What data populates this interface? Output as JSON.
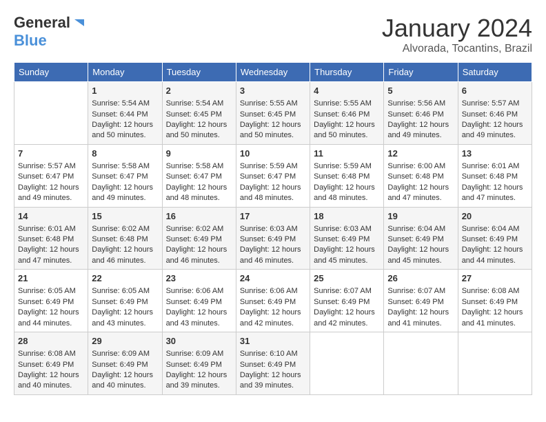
{
  "header": {
    "logo_general": "General",
    "logo_blue": "Blue",
    "month_title": "January 2024",
    "location": "Alvorada, Tocantins, Brazil"
  },
  "columns": [
    "Sunday",
    "Monday",
    "Tuesday",
    "Wednesday",
    "Thursday",
    "Friday",
    "Saturday"
  ],
  "weeks": [
    [
      {
        "day": "",
        "info": ""
      },
      {
        "day": "1",
        "info": "Sunrise: 5:54 AM\nSunset: 6:44 PM\nDaylight: 12 hours\nand 50 minutes."
      },
      {
        "day": "2",
        "info": "Sunrise: 5:54 AM\nSunset: 6:45 PM\nDaylight: 12 hours\nand 50 minutes."
      },
      {
        "day": "3",
        "info": "Sunrise: 5:55 AM\nSunset: 6:45 PM\nDaylight: 12 hours\nand 50 minutes."
      },
      {
        "day": "4",
        "info": "Sunrise: 5:55 AM\nSunset: 6:46 PM\nDaylight: 12 hours\nand 50 minutes."
      },
      {
        "day": "5",
        "info": "Sunrise: 5:56 AM\nSunset: 6:46 PM\nDaylight: 12 hours\nand 49 minutes."
      },
      {
        "day": "6",
        "info": "Sunrise: 5:57 AM\nSunset: 6:46 PM\nDaylight: 12 hours\nand 49 minutes."
      }
    ],
    [
      {
        "day": "7",
        "info": "Sunrise: 5:57 AM\nSunset: 6:47 PM\nDaylight: 12 hours\nand 49 minutes."
      },
      {
        "day": "8",
        "info": "Sunrise: 5:58 AM\nSunset: 6:47 PM\nDaylight: 12 hours\nand 49 minutes."
      },
      {
        "day": "9",
        "info": "Sunrise: 5:58 AM\nSunset: 6:47 PM\nDaylight: 12 hours\nand 48 minutes."
      },
      {
        "day": "10",
        "info": "Sunrise: 5:59 AM\nSunset: 6:47 PM\nDaylight: 12 hours\nand 48 minutes."
      },
      {
        "day": "11",
        "info": "Sunrise: 5:59 AM\nSunset: 6:48 PM\nDaylight: 12 hours\nand 48 minutes."
      },
      {
        "day": "12",
        "info": "Sunrise: 6:00 AM\nSunset: 6:48 PM\nDaylight: 12 hours\nand 47 minutes."
      },
      {
        "day": "13",
        "info": "Sunrise: 6:01 AM\nSunset: 6:48 PM\nDaylight: 12 hours\nand 47 minutes."
      }
    ],
    [
      {
        "day": "14",
        "info": "Sunrise: 6:01 AM\nSunset: 6:48 PM\nDaylight: 12 hours\nand 47 minutes."
      },
      {
        "day": "15",
        "info": "Sunrise: 6:02 AM\nSunset: 6:48 PM\nDaylight: 12 hours\nand 46 minutes."
      },
      {
        "day": "16",
        "info": "Sunrise: 6:02 AM\nSunset: 6:49 PM\nDaylight: 12 hours\nand 46 minutes."
      },
      {
        "day": "17",
        "info": "Sunrise: 6:03 AM\nSunset: 6:49 PM\nDaylight: 12 hours\nand 46 minutes."
      },
      {
        "day": "18",
        "info": "Sunrise: 6:03 AM\nSunset: 6:49 PM\nDaylight: 12 hours\nand 45 minutes."
      },
      {
        "day": "19",
        "info": "Sunrise: 6:04 AM\nSunset: 6:49 PM\nDaylight: 12 hours\nand 45 minutes."
      },
      {
        "day": "20",
        "info": "Sunrise: 6:04 AM\nSunset: 6:49 PM\nDaylight: 12 hours\nand 44 minutes."
      }
    ],
    [
      {
        "day": "21",
        "info": "Sunrise: 6:05 AM\nSunset: 6:49 PM\nDaylight: 12 hours\nand 44 minutes."
      },
      {
        "day": "22",
        "info": "Sunrise: 6:05 AM\nSunset: 6:49 PM\nDaylight: 12 hours\nand 43 minutes."
      },
      {
        "day": "23",
        "info": "Sunrise: 6:06 AM\nSunset: 6:49 PM\nDaylight: 12 hours\nand 43 minutes."
      },
      {
        "day": "24",
        "info": "Sunrise: 6:06 AM\nSunset: 6:49 PM\nDaylight: 12 hours\nand 42 minutes."
      },
      {
        "day": "25",
        "info": "Sunrise: 6:07 AM\nSunset: 6:49 PM\nDaylight: 12 hours\nand 42 minutes."
      },
      {
        "day": "26",
        "info": "Sunrise: 6:07 AM\nSunset: 6:49 PM\nDaylight: 12 hours\nand 41 minutes."
      },
      {
        "day": "27",
        "info": "Sunrise: 6:08 AM\nSunset: 6:49 PM\nDaylight: 12 hours\nand 41 minutes."
      }
    ],
    [
      {
        "day": "28",
        "info": "Sunrise: 6:08 AM\nSunset: 6:49 PM\nDaylight: 12 hours\nand 40 minutes."
      },
      {
        "day": "29",
        "info": "Sunrise: 6:09 AM\nSunset: 6:49 PM\nDaylight: 12 hours\nand 40 minutes."
      },
      {
        "day": "30",
        "info": "Sunrise: 6:09 AM\nSunset: 6:49 PM\nDaylight: 12 hours\nand 39 minutes."
      },
      {
        "day": "31",
        "info": "Sunrise: 6:10 AM\nSunset: 6:49 PM\nDaylight: 12 hours\nand 39 minutes."
      },
      {
        "day": "",
        "info": ""
      },
      {
        "day": "",
        "info": ""
      },
      {
        "day": "",
        "info": ""
      }
    ]
  ]
}
